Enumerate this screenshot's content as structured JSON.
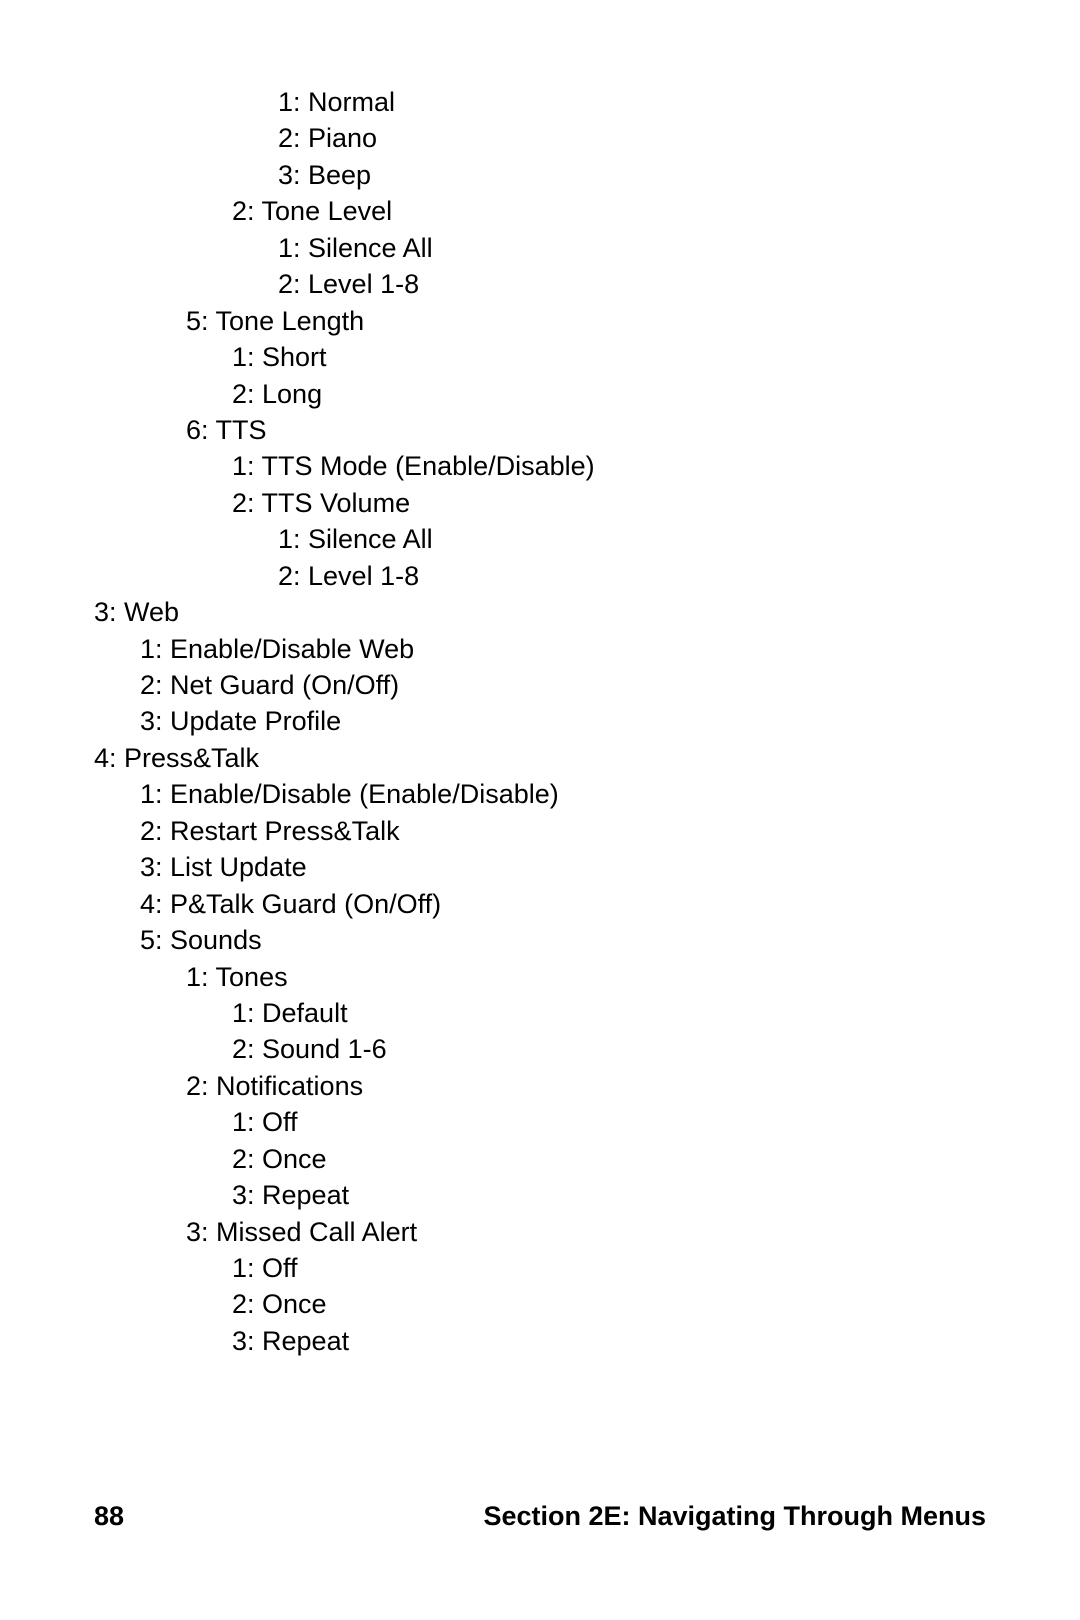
{
  "lines": [
    {
      "indent": 4,
      "text": "1: Normal"
    },
    {
      "indent": 4,
      "text": "2: Piano"
    },
    {
      "indent": 4,
      "text": "3: Beep"
    },
    {
      "indent": 3,
      "text": "2: Tone Level"
    },
    {
      "indent": 4,
      "text": "1: Silence All"
    },
    {
      "indent": 4,
      "text": "2: Level 1-8"
    },
    {
      "indent": 2,
      "text": "5: Tone Length"
    },
    {
      "indent": 3,
      "text": "1: Short"
    },
    {
      "indent": 3,
      "text": "2: Long"
    },
    {
      "indent": 2,
      "text": "6: TTS"
    },
    {
      "indent": 3,
      "text": "1: TTS Mode (Enable/Disable)"
    },
    {
      "indent": 3,
      "text": "2: TTS Volume"
    },
    {
      "indent": 4,
      "text": "1: Silence All"
    },
    {
      "indent": 4,
      "text": "2: Level 1-8"
    },
    {
      "indent": 0,
      "text": "3: Web"
    },
    {
      "indent": 1,
      "text": "1: Enable/Disable Web"
    },
    {
      "indent": 1,
      "text": "2: Net Guard (On/Off)"
    },
    {
      "indent": 1,
      "text": "3: Update Profile"
    },
    {
      "indent": 0,
      "text": "4: Press&Talk"
    },
    {
      "indent": 1,
      "text": "1: Enable/Disable (Enable/Disable)"
    },
    {
      "indent": 1,
      "text": "2: Restart Press&Talk"
    },
    {
      "indent": 1,
      "text": "3: List Update"
    },
    {
      "indent": 1,
      "text": "4: P&Talk Guard (On/Off)"
    },
    {
      "indent": 1,
      "text": "5: Sounds"
    },
    {
      "indent": 2,
      "text": "1: Tones"
    },
    {
      "indent": 3,
      "text": "1: Default"
    },
    {
      "indent": 3,
      "text": "2: Sound 1-6"
    },
    {
      "indent": 2,
      "text": "2: Notifications"
    },
    {
      "indent": 3,
      "text": "1: Off"
    },
    {
      "indent": 3,
      "text": "2: Once"
    },
    {
      "indent": 3,
      "text": "3: Repeat"
    },
    {
      "indent": 2,
      "text": "3: Missed Call Alert"
    },
    {
      "indent": 3,
      "text": "1: Off"
    },
    {
      "indent": 3,
      "text": "2: Once"
    },
    {
      "indent": 3,
      "text": "3: Repeat"
    }
  ],
  "footer": {
    "page_number": "88",
    "section_title": "Section 2E: Navigating Through Menus"
  }
}
